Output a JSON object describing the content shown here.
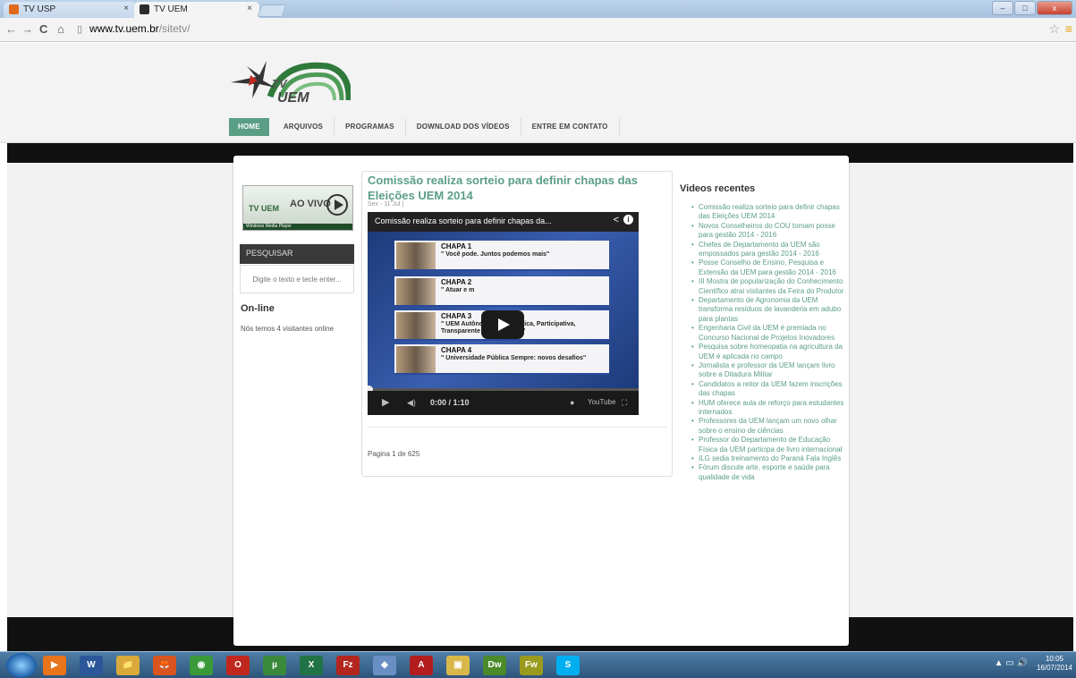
{
  "browser": {
    "tabs": [
      {
        "title": "TV USP"
      },
      {
        "title": "TV UEM"
      }
    ],
    "url_host": "www.tv.uem.br",
    "url_path": "/sitetv/",
    "nav_back": "←",
    "nav_forward": "→",
    "nav_reload": "C",
    "nav_home": "⌂",
    "close_glyph": "×",
    "window_min": "–",
    "window_max": "□",
    "window_close": "x",
    "bookmark_star": "☆",
    "menu_glyph": "≡"
  },
  "site": {
    "logo_text": "UEM",
    "logo_tv": "TV",
    "nav": [
      "HOME",
      "ARQUIVOS",
      "PROGRAMAS",
      "DOWNLOAD DOS VÍDEOS",
      "ENTRE EM CONTATO"
    ],
    "live_label": "AO VIVO",
    "live_tv": "TV UEM",
    "live_player": "Windows Media Player",
    "search_heading": "PESQUISAR",
    "search_placeholder": "Digite o texto e tecle enter...",
    "online_title": "On-line",
    "online_text": "Nós temos 4 visitantes online"
  },
  "article": {
    "title": "Comissão realiza sorteio para definir chapas das Eleições UEM 2014",
    "date": "Sex - 11 Jul |",
    "video_title": "Comissão realiza sorteio para definir chapas da...",
    "share_glyph": "<",
    "info_glyph": "i",
    "time": "0:00 / 1:10",
    "youtube": "YouTube",
    "progress_fraction": 0,
    "chapas": [
      {
        "name": "CHAPA 1",
        "slogan": "\" Você pode. Juntos podemos mais\""
      },
      {
        "name": "CHAPA 2",
        "slogan": "\" Atuar e m"
      },
      {
        "name": "CHAPA 3",
        "slogan": "\" UEM Autônoma, Democrática, Participativa, Transparente e Sustentável\""
      },
      {
        "name": "CHAPA 4",
        "slogan": "\" Universidade Pública Sempre: novos desafios\""
      }
    ],
    "pagination": "Pagina 1 de 625"
  },
  "recent": {
    "title": "Videos recentes",
    "items": [
      "Comissão realiza sorteio para definir chapas das Eleições UEM 2014",
      "Novos Conselheiros do COU tomam posse para gestão 2014 - 2016",
      "Chefes de Departamento da UEM são empossados para gestão 2014 - 2016",
      "Posse Conselho de Ensino, Pesquisa e Extensão da UEM para gestão 2014 - 2016",
      "III Mostra de popularização do Conhecimento Científico atrai visitantes da Feira do Produtor",
      "Departamento de Agronomia da UEM transforma resíduos de lavanderia em adubo para plantas",
      "Engenharia Civil da UEM é premiada no Concurso Nacional de Projetos Inovadores",
      "Pesquisa sobre homeopatia na agricultura da UEM é aplicada no campo",
      "Jornalista e professor da UEM lançam livro sobre a Ditadura Militar",
      "Candidatos a reitor da UEM fazem inscrições das chapas",
      "HUM oferece aula de reforço para estudantes internados",
      "Professores da UEM lançam um novo olhar sobre o ensino de ciências",
      "Professor do Departamento de Educação Física da UEM participa de livro internacional",
      "ILG sedia treinamento do Paraná Fala Inglês",
      "Fórum discute arte, esporte e saúde para qualidade de vida"
    ]
  },
  "taskbar": {
    "apps": [
      {
        "icon": "media-player-icon",
        "label": "▶",
        "color": "#e8741c"
      },
      {
        "icon": "word-icon",
        "label": "W",
        "color": "#2b579a"
      },
      {
        "icon": "explorer-icon",
        "label": "📁",
        "color": "#d9a93a"
      },
      {
        "icon": "firefox-icon",
        "label": "🦊",
        "color": "#d9541e"
      },
      {
        "icon": "chrome-icon",
        "label": "◉",
        "color": "#3a9a3a"
      },
      {
        "icon": "opera-icon",
        "label": "O",
        "color": "#c0281e"
      },
      {
        "icon": "utorrent-icon",
        "label": "µ",
        "color": "#3b8a3b"
      },
      {
        "icon": "excel-icon",
        "label": "X",
        "color": "#217346"
      },
      {
        "icon": "filezilla-icon",
        "label": "Fz",
        "color": "#b3261e"
      },
      {
        "icon": "app-icon",
        "label": "◆",
        "color": "#6a8fc4"
      },
      {
        "icon": "acrobat-icon",
        "label": "A",
        "color": "#b31d1d"
      },
      {
        "icon": "folder-icon",
        "label": "▣",
        "color": "#d9b84a"
      },
      {
        "icon": "dreamweaver-icon",
        "label": "Dw",
        "color": "#4a8a2a"
      },
      {
        "icon": "fireworks-icon",
        "label": "Fw",
        "color": "#9a9a1e"
      },
      {
        "icon": "skype-icon",
        "label": "S",
        "color": "#00aff0"
      }
    ],
    "tray": "▲ ▭ 🔊",
    "time": "10:05",
    "date": "16/07/2014"
  }
}
